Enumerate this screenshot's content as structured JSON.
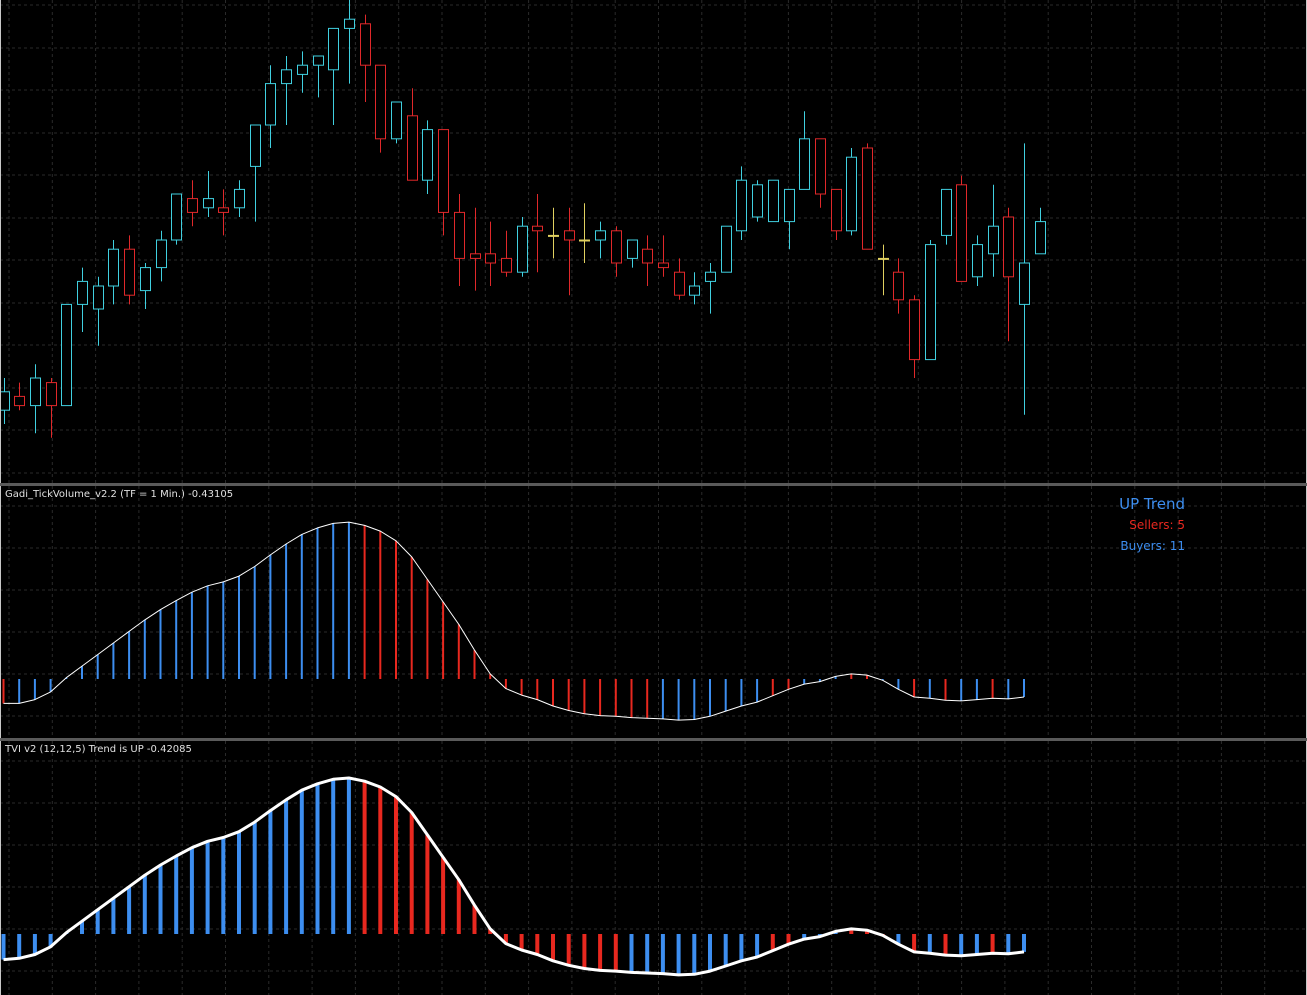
{
  "colors": {
    "background": "#000000",
    "grid": "#2a2a2a",
    "candle_up": "#40d0e0",
    "candle_down": "#e0282a",
    "candle_doji": "#e0d060",
    "bar_up": "#3d8ef0",
    "bar_down": "#e8281f",
    "line": "#ffffff"
  },
  "indicators": {
    "tick_volume_title": "Gadi_TickVolume_v2.2 (TF = 1 Min.) -0.43105",
    "tvi_title": "TVI v2 (12,12,5) Trend is UP -0.42085",
    "trend_text": "UP Trend",
    "sellers_text": "Sellers: 5",
    "buyers_text": "Buyers: 11"
  },
  "chart_data": [
    {
      "type": "candlestick",
      "grid": true,
      "ylim": [
        0,
        100
      ],
      "candles": [
        {
          "o": 13,
          "h": 20,
          "l": 10,
          "c": 17,
          "up": true
        },
        {
          "o": 16,
          "h": 19,
          "l": 13,
          "c": 14,
          "up": false
        },
        {
          "o": 14,
          "h": 23,
          "l": 8,
          "c": 20,
          "up": true
        },
        {
          "o": 19,
          "h": 20,
          "l": 7,
          "c": 14,
          "up": false
        },
        {
          "o": 14,
          "h": 30,
          "l": 14,
          "c": 36,
          "up": true
        },
        {
          "o": 36,
          "h": 44,
          "l": 30,
          "c": 41,
          "up": true
        },
        {
          "o": 35,
          "h": 42,
          "l": 27,
          "c": 40,
          "up": true
        },
        {
          "o": 40,
          "h": 50,
          "l": 36,
          "c": 48,
          "up": true
        },
        {
          "o": 48,
          "h": 51,
          "l": 36,
          "c": 38,
          "up": false
        },
        {
          "o": 39,
          "h": 45,
          "l": 35,
          "c": 44,
          "up": true
        },
        {
          "o": 44,
          "h": 52,
          "l": 41,
          "c": 50,
          "up": true
        },
        {
          "o": 50,
          "h": 60,
          "l": 49,
          "c": 60,
          "up": true
        },
        {
          "o": 59,
          "h": 63,
          "l": 53,
          "c": 56,
          "up": false
        },
        {
          "o": 57,
          "h": 65,
          "l": 55,
          "c": 59,
          "up": true
        },
        {
          "o": 57,
          "h": 61,
          "l": 51,
          "c": 56,
          "up": false
        },
        {
          "o": 57,
          "h": 63,
          "l": 55,
          "c": 61,
          "up": true
        },
        {
          "o": 66,
          "h": 66,
          "l": 54,
          "c": 75,
          "up": true
        },
        {
          "o": 75,
          "h": 88,
          "l": 70,
          "c": 84,
          "up": true
        },
        {
          "o": 84,
          "h": 90,
          "l": 75,
          "c": 87,
          "up": true
        },
        {
          "o": 86,
          "h": 91,
          "l": 82,
          "c": 88,
          "up": true
        },
        {
          "o": 88,
          "h": 87,
          "l": 81,
          "c": 90,
          "up": true
        },
        {
          "o": 87,
          "h": 95,
          "l": 75,
          "c": 96,
          "up": true
        },
        {
          "o": 96,
          "h": 104,
          "l": 84,
          "c": 98,
          "up": true
        },
        {
          "o": 97,
          "h": 99,
          "l": 80,
          "c": 88,
          "up": false
        },
        {
          "o": 88,
          "h": 82,
          "l": 69,
          "c": 72,
          "up": false
        },
        {
          "o": 72,
          "h": 80,
          "l": 71,
          "c": 80,
          "up": true
        },
        {
          "o": 77,
          "h": 83,
          "l": 63,
          "c": 63,
          "up": false
        },
        {
          "o": 63,
          "h": 76,
          "l": 60,
          "c": 74,
          "up": true
        },
        {
          "o": 74,
          "h": 72,
          "l": 51,
          "c": 56,
          "up": false
        },
        {
          "o": 56,
          "h": 60,
          "l": 40,
          "c": 46,
          "up": false
        },
        {
          "o": 47,
          "h": 57,
          "l": 39,
          "c": 46,
          "up": false
        },
        {
          "o": 47,
          "h": 54,
          "l": 40,
          "c": 45,
          "up": false
        },
        {
          "o": 46,
          "h": 52,
          "l": 42,
          "c": 43,
          "up": false
        },
        {
          "o": 43,
          "h": 55,
          "l": 42,
          "c": 53,
          "up": true
        },
        {
          "o": 53,
          "h": 60,
          "l": 43,
          "c": 52,
          "up": false
        },
        {
          "o": 51,
          "h": 57,
          "l": 46,
          "c": 51,
          "up": false
        },
        {
          "o": 52,
          "h": 57,
          "l": 38,
          "c": 50,
          "up": false
        },
        {
          "o": 50,
          "h": 58,
          "l": 45,
          "c": 50,
          "up": true
        },
        {
          "o": 50,
          "h": 54,
          "l": 46,
          "c": 52,
          "up": true
        },
        {
          "o": 52,
          "h": 53,
          "l": 42,
          "c": 45,
          "up": false
        },
        {
          "o": 46,
          "h": 50,
          "l": 44,
          "c": 50,
          "up": true
        },
        {
          "o": 48,
          "h": 51,
          "l": 40,
          "c": 45,
          "up": false
        },
        {
          "o": 45,
          "h": 51,
          "l": 42,
          "c": 44,
          "up": false
        },
        {
          "o": 43,
          "h": 46,
          "l": 37,
          "c": 38,
          "up": false
        },
        {
          "o": 38,
          "h": 43,
          "l": 36,
          "c": 40,
          "up": true
        },
        {
          "o": 41,
          "h": 45,
          "l": 34,
          "c": 43,
          "up": true
        },
        {
          "o": 43,
          "h": 53,
          "l": 43,
          "c": 53,
          "up": true
        },
        {
          "o": 52,
          "h": 66,
          "l": 50,
          "c": 63,
          "up": true
        },
        {
          "o": 55,
          "h": 63,
          "l": 54,
          "c": 62,
          "up": true
        },
        {
          "o": 54,
          "h": 63,
          "l": 55,
          "c": 63,
          "up": true
        },
        {
          "o": 54,
          "h": 60,
          "l": 48,
          "c": 61,
          "up": true
        },
        {
          "o": 61,
          "h": 78,
          "l": 61,
          "c": 72,
          "up": true
        },
        {
          "o": 72,
          "h": 72,
          "l": 57,
          "c": 60,
          "up": false
        },
        {
          "o": 61,
          "h": 60,
          "l": 50,
          "c": 52,
          "up": false
        },
        {
          "o": 52,
          "h": 70,
          "l": 51,
          "c": 68,
          "up": true
        },
        {
          "o": 70,
          "h": 71,
          "l": 48,
          "c": 48,
          "up": false
        },
        {
          "o": 46,
          "h": 49,
          "l": 38,
          "c": 46,
          "up": false
        },
        {
          "o": 43,
          "h": 46,
          "l": 34,
          "c": 37,
          "up": false
        },
        {
          "o": 37,
          "h": 38,
          "l": 20,
          "c": 24,
          "up": false
        },
        {
          "o": 24,
          "h": 50,
          "l": 24,
          "c": 49,
          "up": true
        },
        {
          "o": 51,
          "h": 61,
          "l": 49,
          "c": 61,
          "up": true
        },
        {
          "o": 62,
          "h": 64,
          "l": 41,
          "c": 41,
          "up": false
        },
        {
          "o": 42,
          "h": 51,
          "l": 40,
          "c": 49,
          "up": true
        },
        {
          "o": 47,
          "h": 62,
          "l": 42,
          "c": 53,
          "up": true
        },
        {
          "o": 55,
          "h": 57,
          "l": 28,
          "c": 42,
          "up": false
        },
        {
          "o": 36,
          "h": 71,
          "l": 12,
          "c": 45,
          "up": true
        },
        {
          "o": 47,
          "h": 57,
          "l": 47,
          "c": 54,
          "up": true
        }
      ]
    },
    {
      "type": "bar",
      "title": "Gadi_TickVolume_v2.2 (TF = 1 Min.) -0.43105",
      "ylim": [
        -0.6,
        2.8
      ],
      "baseline": 0,
      "values": [
        -0.38,
        -0.38,
        -0.32,
        -0.2,
        0.02,
        0.2,
        0.38,
        0.56,
        0.74,
        0.92,
        1.08,
        1.22,
        1.35,
        1.45,
        1.51,
        1.6,
        1.75,
        1.93,
        2.1,
        2.25,
        2.35,
        2.42,
        2.44,
        2.39,
        2.3,
        2.15,
        1.9,
        1.55,
        1.2,
        0.85,
        0.45,
        0.08,
        -0.15,
        -0.25,
        -0.32,
        -0.42,
        -0.49,
        -0.54,
        -0.57,
        -0.58,
        -0.6,
        -0.61,
        -0.62,
        -0.64,
        -0.63,
        -0.58,
        -0.5,
        -0.42,
        -0.36,
        -0.26,
        -0.16,
        -0.08,
        -0.04,
        0.04,
        0.08,
        0.06,
        -0.02,
        -0.16,
        -0.28,
        -0.3,
        -0.33,
        -0.34,
        -0.32,
        -0.3,
        -0.31,
        -0.28
      ],
      "direction": [
        "d",
        "u",
        "u",
        "u",
        "u",
        "u",
        "u",
        "u",
        "u",
        "u",
        "u",
        "u",
        "u",
        "u",
        "u",
        "u",
        "u",
        "u",
        "u",
        "u",
        "u",
        "u",
        "u",
        "d",
        "d",
        "d",
        "d",
        "d",
        "d",
        "d",
        "d",
        "d",
        "d",
        "d",
        "d",
        "d",
        "d",
        "d",
        "d",
        "d",
        "d",
        "d",
        "u",
        "u",
        "u",
        "u",
        "u",
        "u",
        "u",
        "d",
        "d",
        "u",
        "u",
        "u",
        "d",
        "d",
        "u",
        "u",
        "d",
        "u",
        "d",
        "u",
        "u",
        "d",
        "u",
        "u"
      ]
    },
    {
      "type": "bar",
      "title": "TVI v2 (12,12,5) Trend is UP -0.42085",
      "ylim": [
        -0.6,
        2.8
      ],
      "baseline": 0,
      "values": [
        -0.4,
        -0.38,
        -0.32,
        -0.2,
        0.02,
        0.2,
        0.38,
        0.56,
        0.74,
        0.92,
        1.08,
        1.22,
        1.35,
        1.45,
        1.51,
        1.6,
        1.75,
        1.93,
        2.1,
        2.25,
        2.35,
        2.42,
        2.44,
        2.39,
        2.3,
        2.15,
        1.9,
        1.55,
        1.2,
        0.85,
        0.45,
        0.08,
        -0.15,
        -0.25,
        -0.32,
        -0.42,
        -0.49,
        -0.54,
        -0.57,
        -0.58,
        -0.6,
        -0.61,
        -0.62,
        -0.64,
        -0.63,
        -0.58,
        -0.5,
        -0.42,
        -0.36,
        -0.26,
        -0.16,
        -0.08,
        -0.04,
        0.04,
        0.08,
        0.06,
        -0.02,
        -0.16,
        -0.28,
        -0.3,
        -0.33,
        -0.34,
        -0.32,
        -0.3,
        -0.31,
        -0.28
      ],
      "direction": [
        "u",
        "u",
        "u",
        "u",
        "u",
        "u",
        "u",
        "u",
        "u",
        "u",
        "u",
        "u",
        "u",
        "u",
        "u",
        "u",
        "u",
        "u",
        "u",
        "u",
        "u",
        "u",
        "u",
        "d",
        "d",
        "d",
        "d",
        "d",
        "d",
        "d",
        "d",
        "d",
        "d",
        "d",
        "d",
        "d",
        "d",
        "d",
        "d",
        "d",
        "u",
        "u",
        "u",
        "u",
        "u",
        "u",
        "u",
        "u",
        "u",
        "d",
        "d",
        "u",
        "u",
        "u",
        "d",
        "d",
        "d",
        "u",
        "d",
        "u",
        "d",
        "u",
        "u",
        "d",
        "u",
        "u"
      ]
    }
  ]
}
